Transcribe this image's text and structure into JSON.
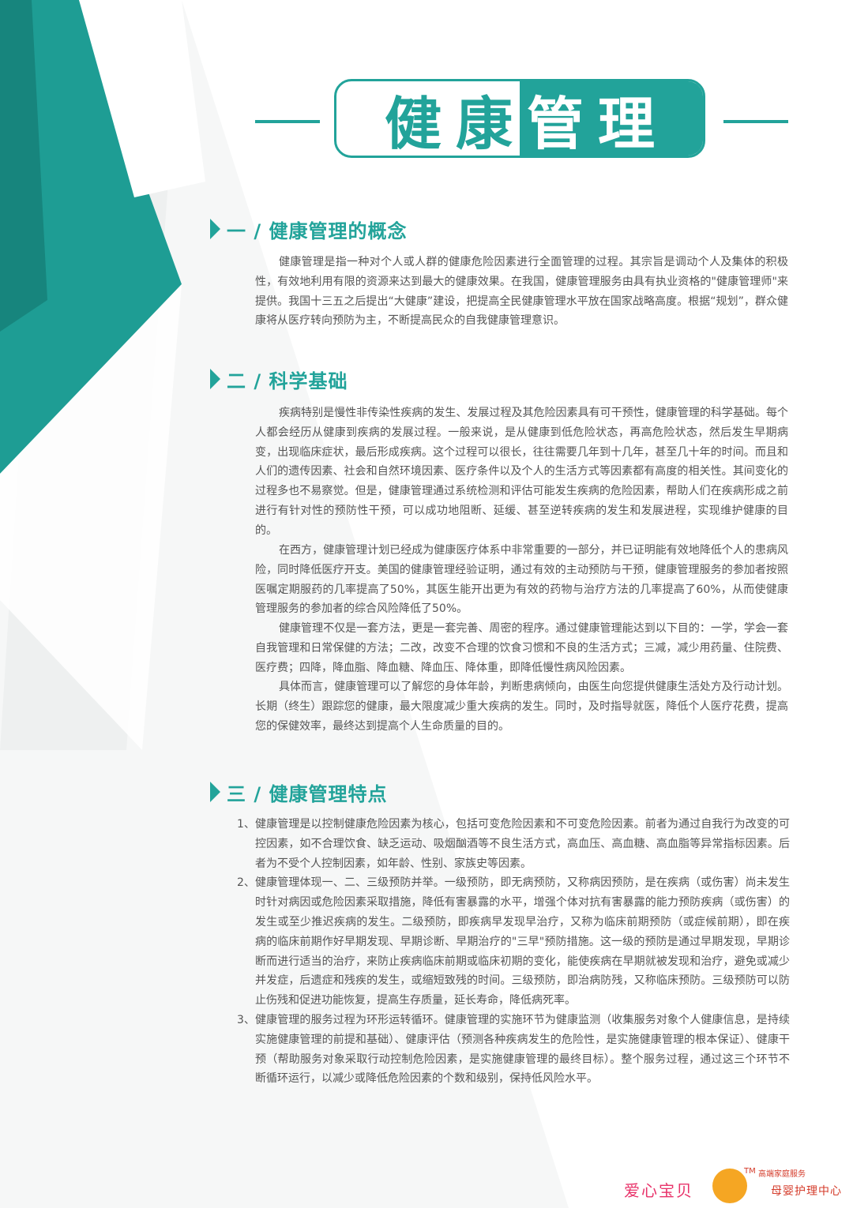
{
  "banner": {
    "title_part1": "健康",
    "title_part2": "管理",
    "accent_color": "#22a39a"
  },
  "sections": [
    {
      "heading": "一 / 健康管理的概念",
      "paragraphs": [
        "健康管理是指一种对个人或人群的健康危险因素进行全面管理的过程。其宗旨是调动个人及集体的积极性，有效地利用有限的资源来达到最大的健康效果。在我国，健康管理服务由具有执业资格的\"健康管理师\"来提供。我国十三五之后提出“大健康”建设，把提高全民健康管理水平放在国家战略高度。根据“规划”，群众健康将从医疗转向预防为主，不断提高民众的自我健康管理意识。"
      ]
    },
    {
      "heading": "二 / 科学基础",
      "paragraphs": [
        "疾病特别是慢性非传染性疾病的发生、发展过程及其危险因素具有可干预性，健康管理的科学基础。每个人都会经历从健康到疾病的发展过程。一般来说，是从健康到低危险状态，再高危险状态，然后发生早期病变，出现临床症状，最后形成疾病。这个过程可以很长，往往需要几年到十几年，甚至几十年的时间。而且和人们的遗传因素、社会和自然环境因素、医疗条件以及个人的生活方式等因素都有高度的相关性。其间变化的过程多也不易察觉。但是，健康管理通过系统检测和评估可能发生疾病的危险因素，帮助人们在疾病形成之前进行有针对性的预防性干预，可以成功地阻断、延缓、甚至逆转疾病的发生和发展进程，实现维护健康的目的。",
        "在西方，健康管理计划已经成为健康医疗体系中非常重要的一部分，并已证明能有效地降低个人的患病风险，同时降低医疗开支。美国的健康管理经验证明，通过有效的主动预防与干预，健康管理服务的参加者按照医嘱定期服药的几率提高了50%，其医生能开出更为有效的药物与治疗方法的几率提高了60%，从而使健康管理服务的参加者的综合风险降低了50%。",
        "健康管理不仅是一套方法，更是一套完善、周密的程序。通过健康管理能达到以下目的：一学，学会一套自我管理和日常保健的方法；二改，改变不合理的饮食习惯和不良的生活方式；三减，减少用药量、住院费、医疗费；四降，降血脂、降血糖、降血压、降体重，即降低慢性病风险因素。",
        "具体而言，健康管理可以了解您的身体年龄，判断患病倾向，由医生向您提供健康生活处方及行动计划。长期（终生）跟踪您的健康，最大限度减少重大疾病的发生。同时，及时指导就医，降低个人医疗花费，提高您的保健效率，最终达到提高个人生命质量的目的。"
      ]
    },
    {
      "heading": "三 / 健康管理特点",
      "items": [
        {
          "num": "1、",
          "text": "健康管理是以控制健康危险因素为核心，包括可变危险因素和不可变危险因素。前者为通过自我行为改变的可控因素，如不合理饮食、缺乏运动、吸烟酗酒等不良生活方式，高血压、高血糖、高血脂等异常指标因素。后者为不受个人控制因素，如年龄、性别、家族史等因素。"
        },
        {
          "num": "2、",
          "text": "健康管理体现一、二、三级预防并举。一级预防，即无病预防，又称病因预防，是在疾病（或伤害）尚未发生时针对病因或危险因素采取措施，降低有害暴露的水平，增强个体对抗有害暴露的能力预防疾病（或伤害）的发生或至少推迟疾病的发生。二级预防，即疾病早发现早治疗，又称为临床前期预防（或症候前期），即在疾病的临床前期作好早期发现、早期诊断、早期治疗的\"三早\"预防措施。这一级的预防是通过早期发现，早期诊断而进行适当的治疗，来防止疾病临床前期或临床初期的变化，能使疾病在早期就被发现和治疗，避免或减少并发症，后遗症和残疾的发生，或缩短致残的时间。三级预防，即治病防残，又称临床预防。三级预防可以防止伤残和促进功能恢复，提高生存质量，延长寿命，降低病死率。"
        },
        {
          "num": "3、",
          "text": "健康管理的服务过程为环形运转循环。健康管理的实施环节为健康监测（收集服务对象个人健康信息，是持续实施健康管理的前提和基础）、健康评估（预测各种疾病发生的危险性，是实施健康管理的根本保证）、健康干预（帮助服务对象采取行动控制危险因素，是实施健康管理的最终目标）。整个服务过程，通过这三个环节不断循环运行，以减少或降低危险因素的个数和级别，保持低风险水平。"
        }
      ]
    }
  ],
  "footer": {
    "tm": "TM",
    "small_text": "高端家庭服务",
    "left_text": "爱心宝贝",
    "right_text": "母婴护理中心"
  }
}
